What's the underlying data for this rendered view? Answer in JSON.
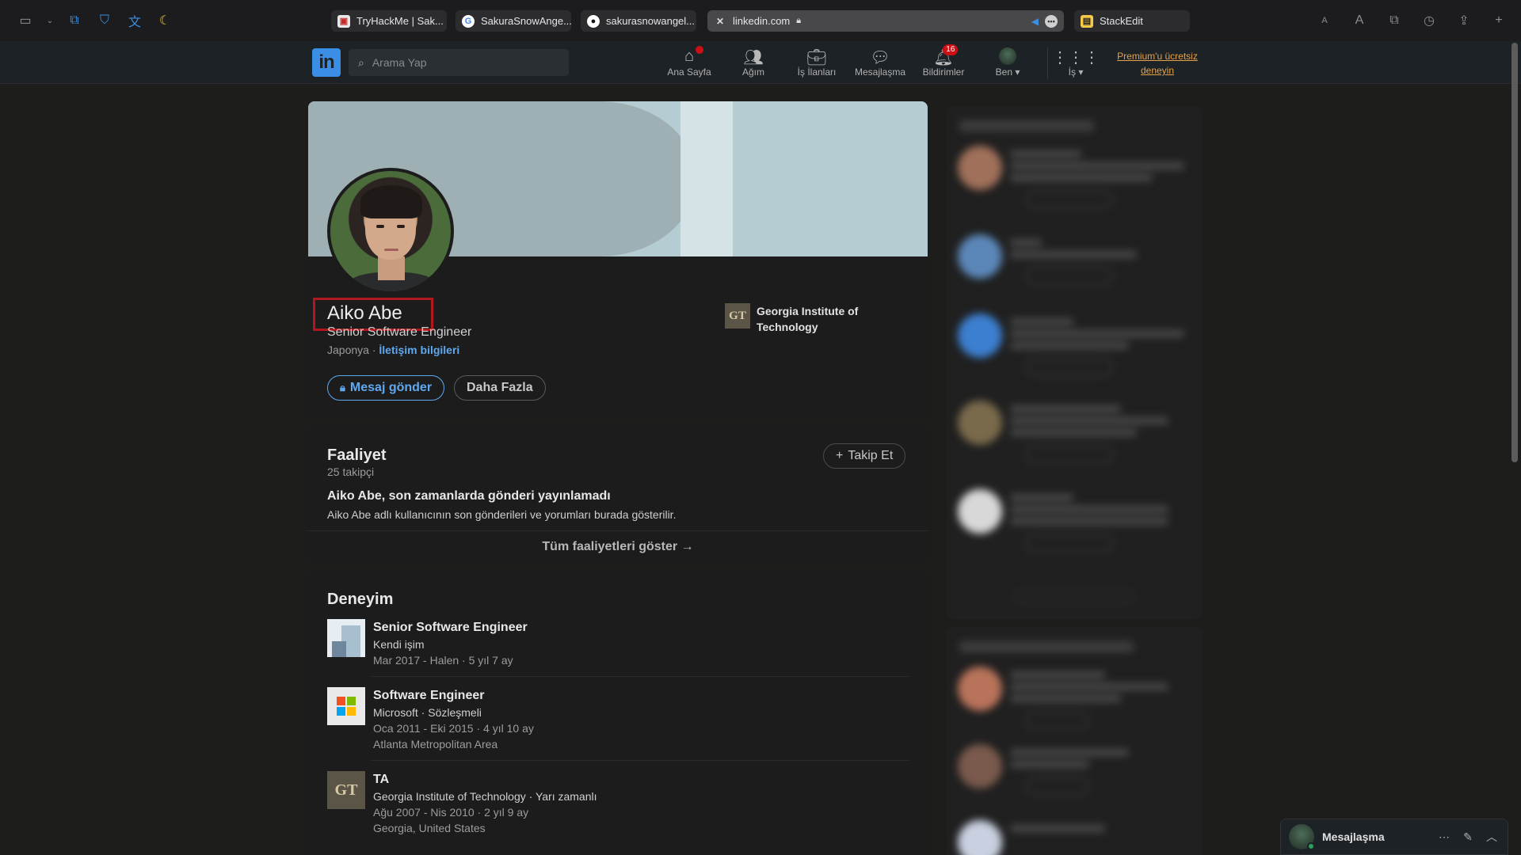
{
  "browser": {
    "tabs": [
      {
        "label": "TryHackMe | Sak...",
        "icon": "tryhackme-icon"
      },
      {
        "label": "SakuraSnowAnge...",
        "icon": "google-icon"
      },
      {
        "label": "sakurasnowangel...",
        "icon": "github-icon"
      },
      {
        "label": "linkedin.com",
        "icon": "linkedin-icon"
      },
      {
        "label": "StackEdit",
        "icon": "stackedit-icon"
      }
    ],
    "font_small": "A",
    "font_large": "A"
  },
  "linkedin_nav": {
    "logo": "in",
    "search_placeholder": "Arama Yap",
    "items": [
      {
        "label": "Ana Sayfa",
        "icon": "home-icon",
        "badge": ""
      },
      {
        "label": "Ağım",
        "icon": "network-icon",
        "badge": ""
      },
      {
        "label": "İş İlanları",
        "icon": "briefcase-icon",
        "badge": ""
      },
      {
        "label": "Mesajlaşma",
        "icon": "messaging-icon",
        "badge": ""
      },
      {
        "label": "Bildirimler",
        "icon": "bell-icon",
        "badge": "16"
      },
      {
        "label": "Ben",
        "icon": "avatar-icon",
        "badge": ""
      },
      {
        "label": "İş",
        "icon": "grid-icon",
        "badge": ""
      }
    ],
    "premium": "Premium'u ücretsiz deneyin"
  },
  "profile": {
    "name": "Aiko Abe",
    "headline": "Senior Software Engineer",
    "location": "Japonya",
    "contact_link": "İletişim bilgileri",
    "education": "Georgia Institute of Technology",
    "education_logo": "GT",
    "message_button": "Mesaj gönder",
    "more_button": "Daha Fazla"
  },
  "activity": {
    "title": "Faaliyet",
    "followers": "25 takipçi",
    "follow_button": "Takip Et",
    "empty_title": "Aiko Abe, son zamanlarda gönderi yayınlamadı",
    "empty_desc": "Aiko Abe adlı kullanıcının son gönderileri ve yorumları burada gösterilir.",
    "show_all": "Tüm faaliyetleri göster →"
  },
  "experience": {
    "title": "Deneyim",
    "items": [
      {
        "title": "Senior Software Engineer",
        "company": "Kendi işim",
        "dates": "Mar 2017 - Halen · 5 yıl 7 ay",
        "location": ""
      },
      {
        "title": "Software Engineer",
        "company": "Microsoft · Sözleşmeli",
        "dates": "Oca 2011 - Eki 2015 · 4 yıl 10 ay",
        "location": "Atlanta Metropolitan Area"
      },
      {
        "title": "TA",
        "company": "Georgia Institute of Technology · Yarı zamanlı",
        "dates": "Ağu 2007 - Nis 2010 · 2 yıl 9 ay",
        "location": "Georgia, United States"
      }
    ]
  },
  "messaging_dock": {
    "label": "Mesajlaşma"
  },
  "colors": {
    "accent": "#5fa8f0",
    "linkedin_blue": "#3a8ee6",
    "badge_red": "#cc1016",
    "highlight_box": "#b1171c",
    "premium": "#e3a24b"
  }
}
